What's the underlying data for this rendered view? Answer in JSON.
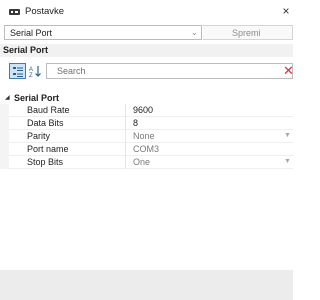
{
  "window": {
    "title": "Postavke",
    "close_glyph": "×"
  },
  "toolbar": {
    "selected_object": "Serial Port",
    "chevron": "⌄",
    "save_label": "Spremi"
  },
  "property_grid": {
    "heading": "Serial Port",
    "search_placeholder": "Search",
    "clear_glyph": "✕",
    "category": {
      "label": "Serial Port",
      "expanded": true,
      "properties": [
        {
          "name": "Baud Rate",
          "value": "9600",
          "editable": true,
          "has_dropdown": false
        },
        {
          "name": "Data Bits",
          "value": "8",
          "editable": true,
          "has_dropdown": false
        },
        {
          "name": "Parity",
          "value": "None",
          "editable": false,
          "has_dropdown": true
        },
        {
          "name": "Port name",
          "value": "COM3",
          "editable": false,
          "has_dropdown": false
        },
        {
          "name": "Stop Bits",
          "value": "One",
          "editable": false,
          "has_dropdown": true
        }
      ]
    }
  },
  "icons": {
    "categorized": "categorized-view-icon",
    "alphabetical": "sort-alphabetical-icon"
  },
  "colors": {
    "selected_button_bg": "#cce4f7",
    "selected_button_border": "#3c7fb1",
    "clear_red": "#e03030",
    "muted_text": "#7a7a7a"
  }
}
